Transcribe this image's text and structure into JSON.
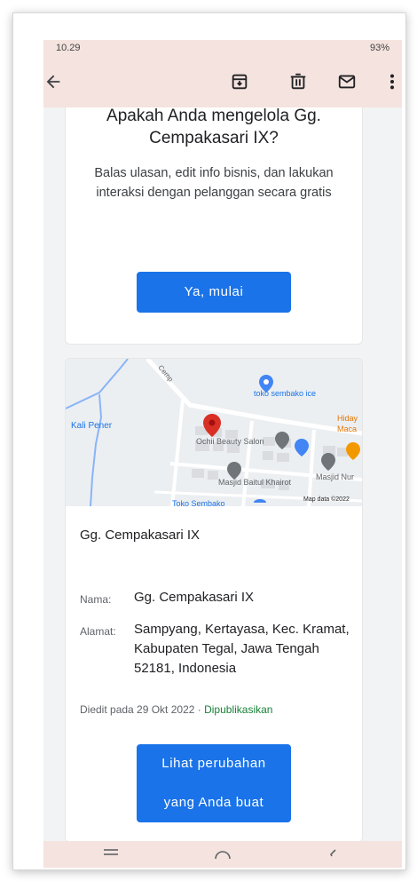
{
  "status_bar": {
    "time": "10.29",
    "battery": "93%"
  },
  "toolbar": {
    "back_icon": "arrow-left-icon",
    "archive_icon": "archive-icon",
    "delete_icon": "trash-icon",
    "mail_icon": "mail-icon",
    "more_icon": "more-vert-icon"
  },
  "claim_card": {
    "headline": "Apakah Anda mengelola Gg. Cempakasari IX?",
    "subtitle": "Balas ulasan, edit info bisnis, dan lakukan interaksi dengan pelanggan secara gratis",
    "button_label": "Ya, mulai"
  },
  "map": {
    "labels": {
      "kali_pener": "Kali Pener",
      "toko_sembako_ice": "toko sembako ice",
      "ochii": "Ochii Beauty Salon",
      "hiday": "Hiday",
      "maca": "Maca",
      "masjid_baitul": "Masjid Baitul Khairot",
      "masjid_nur": "Masjid Nur",
      "toko_sembako": "Toko Sembako",
      "road": "Cemp",
      "map_data": "Map data ©2022"
    }
  },
  "place_card": {
    "title": "Gg. Cempakasari IX",
    "name_label": "Nama:",
    "name_value": "Gg. Cempakasari IX",
    "address_label": "Alamat:",
    "address_value": "Sampyang, Kertayasa, Kec. Kramat, Kabupaten Tegal, Jawa Tengah 52181, Indonesia",
    "edited_text": "Diedit pada 29 Okt 2022 · ",
    "published_text": "Dipublikasikan",
    "button_line1": "Lihat perubahan",
    "button_line2": "yang Anda buat"
  },
  "colors": {
    "accent": "#1a73e8",
    "toolbar_bg": "#f4e3de",
    "published": "#188038",
    "pin": "#d93025"
  }
}
